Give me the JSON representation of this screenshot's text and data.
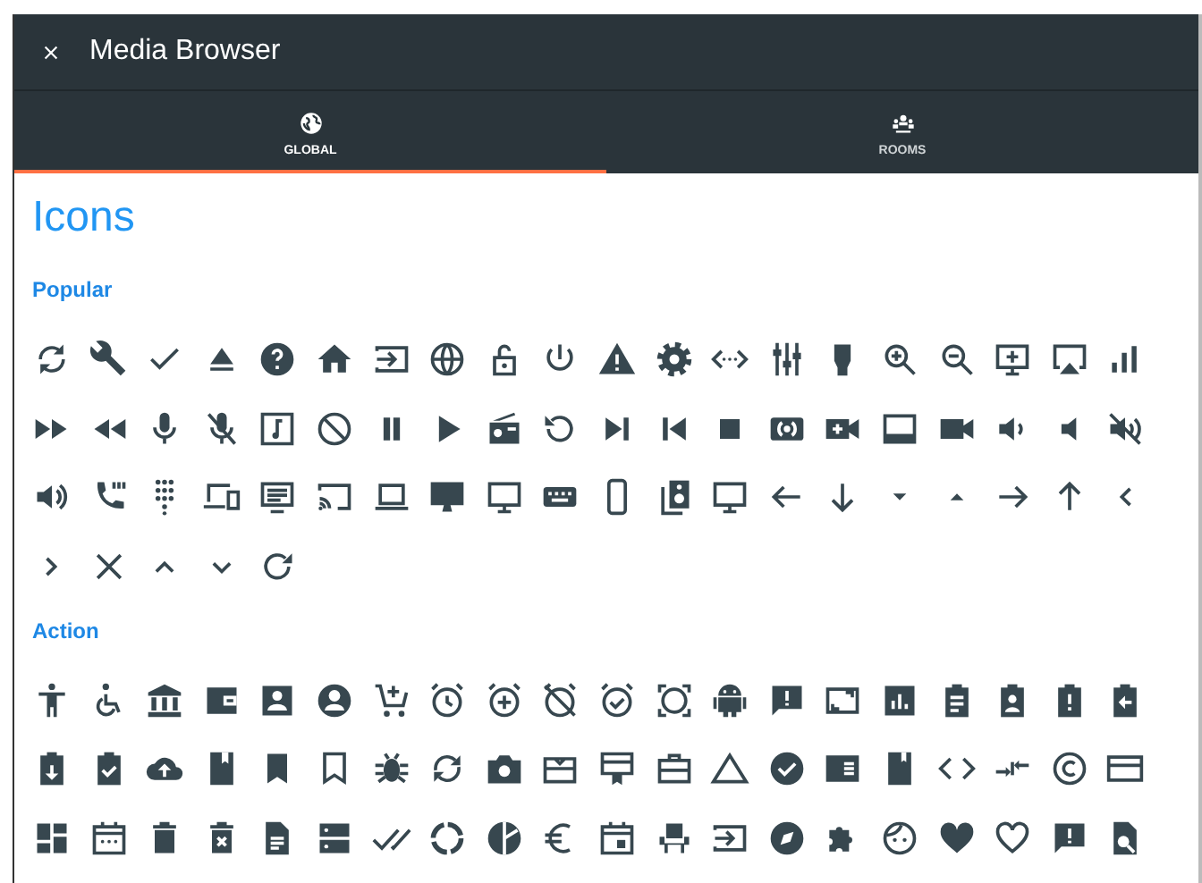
{
  "window": {
    "title": "Media Browser"
  },
  "tabs": [
    {
      "label": "GLOBAL",
      "selected": true
    },
    {
      "label": "ROOMS",
      "selected": false
    }
  ],
  "heading": "Icons",
  "sections": [
    {
      "title": "Popular"
    },
    {
      "title": "Action"
    }
  ]
}
